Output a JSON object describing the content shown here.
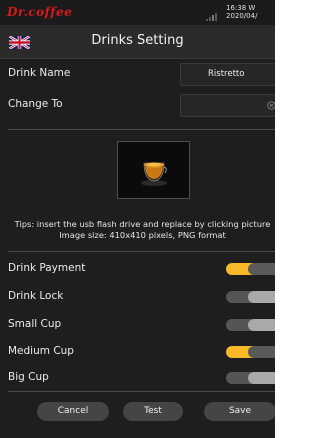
{
  "status_bar": {
    "brand": "Dr.coffee",
    "time": "16:38 W",
    "date": "2020/04/"
  },
  "header": {
    "title": "Drinks Setting",
    "language_icon": "uk-flag-icon"
  },
  "form": {
    "drink_name": {
      "label": "Drink Name",
      "value": "Ristretto"
    },
    "change_to": {
      "label": "Change To",
      "value": "",
      "clear_icon": "clear-icon"
    }
  },
  "picture": {
    "icon": "espresso-cup-icon",
    "tip_line1": "Tips: insert the usb flash drive and replace by clicking picture",
    "tip_line2": "Image size: 410x410 pixels, PNG format"
  },
  "settings": [
    {
      "label": "Drink Payment",
      "on": true
    },
    {
      "label": "Drink Lock",
      "on": false
    },
    {
      "label": "Small Cup",
      "on": false
    },
    {
      "label": "Medium Cup",
      "on": true
    },
    {
      "label": "Big Cup",
      "on": false
    }
  ],
  "buttons": {
    "cancel": "Cancel",
    "test": "Test",
    "save": "Save"
  },
  "colors": {
    "brand": "#d8191c",
    "toggle_on": "#f7b928",
    "background": "#1e1e1e"
  }
}
